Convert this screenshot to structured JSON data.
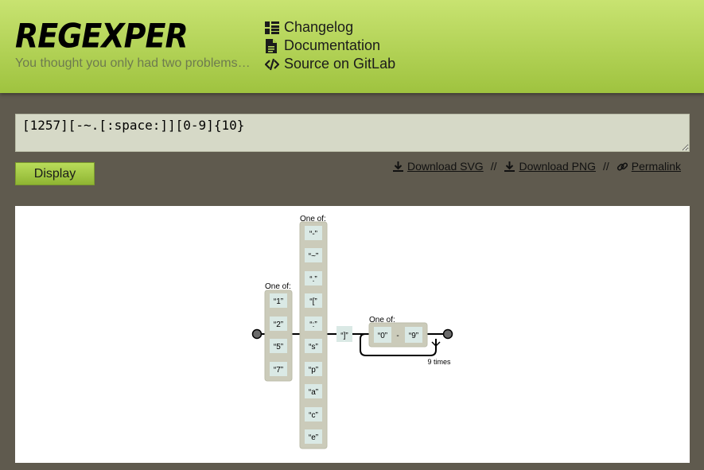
{
  "header": {
    "logo": "REGEXPER",
    "tagline": "You thought you only had two problems…",
    "nav": [
      {
        "label": "Changelog",
        "icon": "list-icon"
      },
      {
        "label": "Documentation",
        "icon": "document-icon"
      },
      {
        "label": "Source on GitLab",
        "icon": "code-icon"
      }
    ]
  },
  "form": {
    "regex_value": "[1257][-~.[:space:]][0-9]{10}",
    "display_label": "Display"
  },
  "actions": {
    "download_svg": "Download SVG",
    "download_png": "Download PNG",
    "permalink": "Permalink",
    "separator": "//"
  },
  "diagram": {
    "group1": {
      "label": "One of:",
      "items": [
        "“1”",
        "“2”",
        "“5”",
        "“7”"
      ]
    },
    "group2": {
      "label": "One of:",
      "items": [
        "“-”",
        "“~”",
        "“.”",
        "“[”",
        "“:”",
        "“s”",
        "“p”",
        "“a”",
        "“c”",
        "“e”"
      ]
    },
    "literal": "“]”",
    "group3": {
      "label": "One of:",
      "range_from": "“0”",
      "range_dash": "-",
      "range_to": "“9”"
    },
    "repeat_label": "9 times"
  }
}
